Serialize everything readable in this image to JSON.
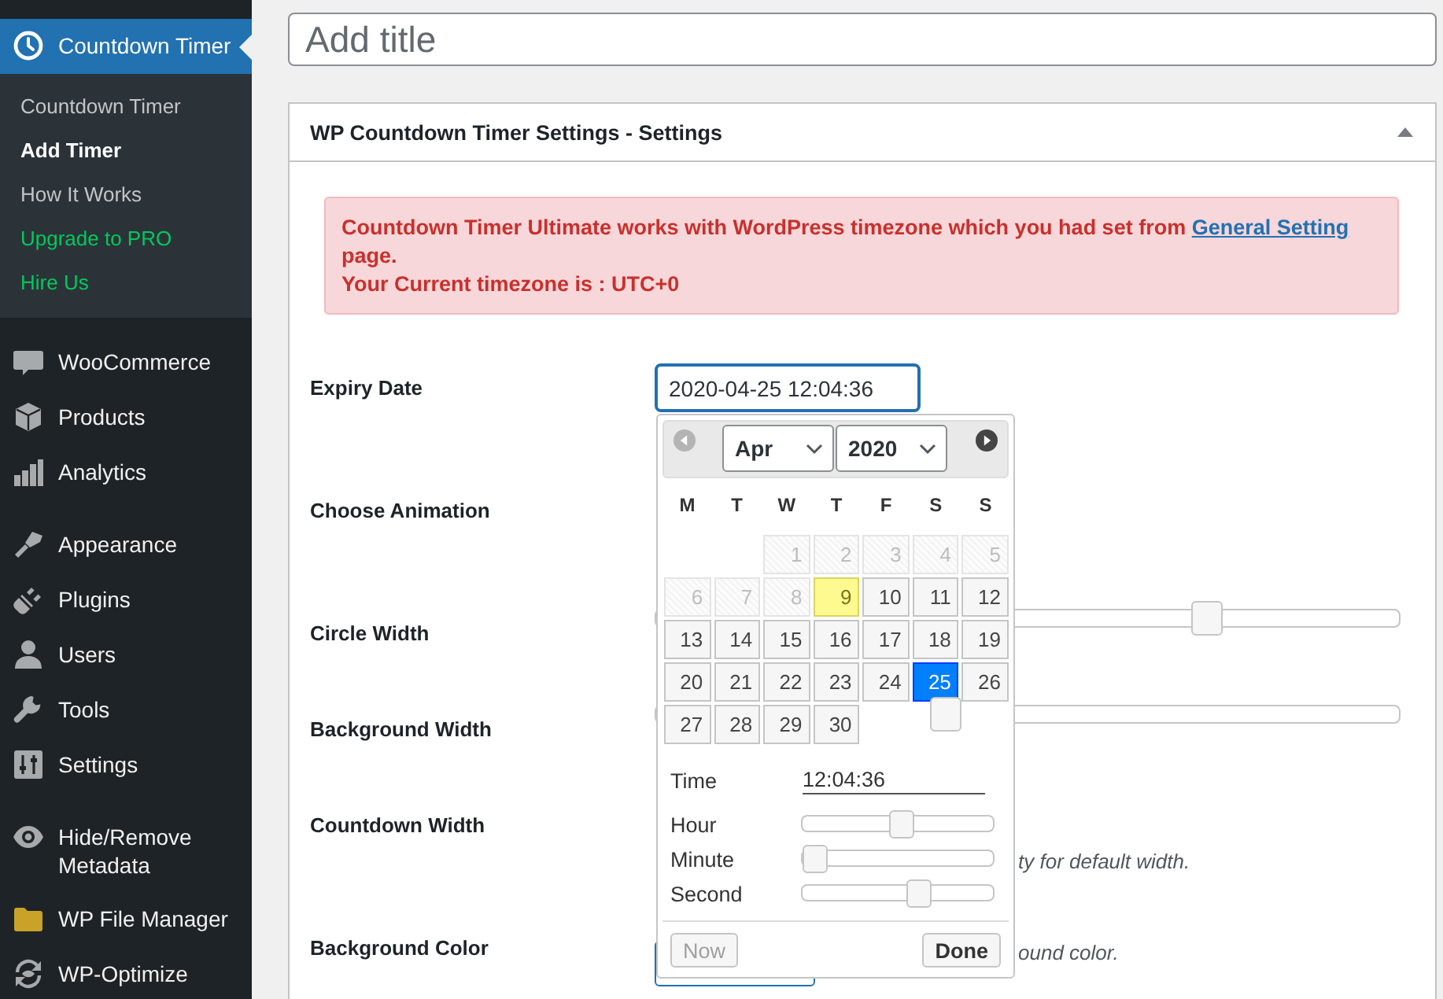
{
  "sidebar": {
    "groups": [
      {
        "items": [
          {
            "label": "Countdown Timer",
            "selected": true,
            "submenu": [
              {
                "label": "Countdown Timer",
                "kind": "page",
                "selected": false
              },
              {
                "label": "Add Timer",
                "kind": "page",
                "selected": true
              },
              {
                "label": "How It Works",
                "kind": "page",
                "selected": false
              },
              {
                "label": "Upgrade to PRO",
                "kind": "promo",
                "selected": false
              },
              {
                "label": "Hire Us",
                "kind": "promo",
                "selected": false
              }
            ]
          }
        ]
      },
      {
        "items": [
          {
            "label": "WooCommerce",
            "selected": false
          },
          {
            "label": "Products",
            "selected": false
          },
          {
            "label": "Analytics",
            "selected": false
          }
        ]
      },
      {
        "items": [
          {
            "label": "Appearance",
            "selected": false
          },
          {
            "label": "Plugins",
            "selected": false
          },
          {
            "label": "Users",
            "selected": false
          },
          {
            "label": "Tools",
            "selected": false
          },
          {
            "label": "Settings",
            "selected": false
          }
        ]
      },
      {
        "items": [
          {
            "label": "Hide/Remove Metadata",
            "selected": false
          },
          {
            "label": "WP File Manager",
            "selected": false
          },
          {
            "label": "WP-Optimize",
            "selected": false
          }
        ]
      }
    ]
  },
  "title_input": {
    "placeholder": "Add title"
  },
  "settings_panel": {
    "title": "WP Countdown Timer Settings - Settings",
    "expanded": true,
    "notice": {
      "text": "Countdown Timer Ultimate works with WordPress timezone which you had set from",
      "link": "General Setting",
      "text_after": "page.",
      "timezone_line": "Your Current timezone is : UTC+0"
    },
    "fields": [
      {
        "kind": "date",
        "label": "Expiry Date",
        "value": "2020-04-25 12:04:36"
      },
      {
        "kind": "select",
        "label": "Choose Animation"
      },
      {
        "kind": "slider",
        "label": "Circle Width",
        "level": 0.74
      },
      {
        "kind": "slider",
        "label": "Background Width",
        "level": 0.39
      },
      {
        "kind": "number",
        "label": "Countdown Width",
        "hint": "ty for default width."
      },
      {
        "kind": "color",
        "label": "Background Color",
        "hint": "ound color."
      }
    ]
  },
  "datepicker": {
    "prev_disabled": true,
    "next_disabled": false,
    "month": "Apr",
    "year": "2020",
    "weekdays": [
      "M",
      "T",
      "W",
      "T",
      "F",
      "S",
      "S"
    ],
    "weeks": [
      [
        {
          "day": "1",
          "disabled": true,
          "today": false,
          "selected": false
        },
        {
          "day": "2",
          "disabled": true,
          "today": false,
          "selected": false
        },
        {
          "day": "3",
          "disabled": true,
          "today": false,
          "selected": false
        },
        {
          "day": "4",
          "disabled": true,
          "today": false,
          "selected": false
        },
        {
          "day": "5",
          "disabled": true,
          "today": false,
          "selected": false
        }
      ],
      [
        {
          "day": "6",
          "disabled": true,
          "today": false,
          "selected": false
        },
        {
          "day": "7",
          "disabled": true,
          "today": false,
          "selected": false
        },
        {
          "day": "8",
          "disabled": true,
          "today": false,
          "selected": false
        },
        {
          "day": "9",
          "disabled": false,
          "today": true,
          "selected": false
        },
        {
          "day": "10",
          "disabled": false,
          "today": false,
          "selected": false
        },
        {
          "day": "11",
          "disabled": false,
          "today": false,
          "selected": false
        },
        {
          "day": "12",
          "disabled": false,
          "today": false,
          "selected": false
        }
      ],
      [
        {
          "day": "13",
          "disabled": false,
          "today": false,
          "selected": false
        },
        {
          "day": "14",
          "disabled": false,
          "today": false,
          "selected": false
        },
        {
          "day": "15",
          "disabled": false,
          "today": false,
          "selected": false
        },
        {
          "day": "16",
          "disabled": false,
          "today": false,
          "selected": false
        },
        {
          "day": "17",
          "disabled": false,
          "today": false,
          "selected": false
        },
        {
          "day": "18",
          "disabled": false,
          "today": false,
          "selected": false
        },
        {
          "day": "19",
          "disabled": false,
          "today": false,
          "selected": false
        }
      ],
      [
        {
          "day": "20",
          "disabled": false,
          "today": false,
          "selected": false
        },
        {
          "day": "21",
          "disabled": false,
          "today": false,
          "selected": false
        },
        {
          "day": "22",
          "disabled": false,
          "today": false,
          "selected": false
        },
        {
          "day": "23",
          "disabled": false,
          "today": false,
          "selected": false
        },
        {
          "day": "24",
          "disabled": false,
          "today": false,
          "selected": false
        },
        {
          "day": "25",
          "disabled": false,
          "today": false,
          "selected": true
        },
        {
          "day": "26",
          "disabled": false,
          "today": false,
          "selected": false
        }
      ],
      [
        {
          "day": "27",
          "disabled": false,
          "today": false,
          "selected": false
        },
        {
          "day": "28",
          "disabled": false,
          "today": false,
          "selected": false
        },
        {
          "day": "29",
          "disabled": false,
          "today": false,
          "selected": false
        },
        {
          "day": "30",
          "disabled": false,
          "today": false,
          "selected": false
        }
      ]
    ],
    "time_label": "Time",
    "time_value": "12:04:36",
    "sliders": [
      {
        "label": "Hour",
        "level": 0.52
      },
      {
        "label": "Minute",
        "level": 0.07
      },
      {
        "label": "Second",
        "level": 0.61
      }
    ],
    "buttons": [
      {
        "label": "Now",
        "kind": "secondary"
      },
      {
        "label": "Done",
        "kind": "primary"
      }
    ]
  }
}
